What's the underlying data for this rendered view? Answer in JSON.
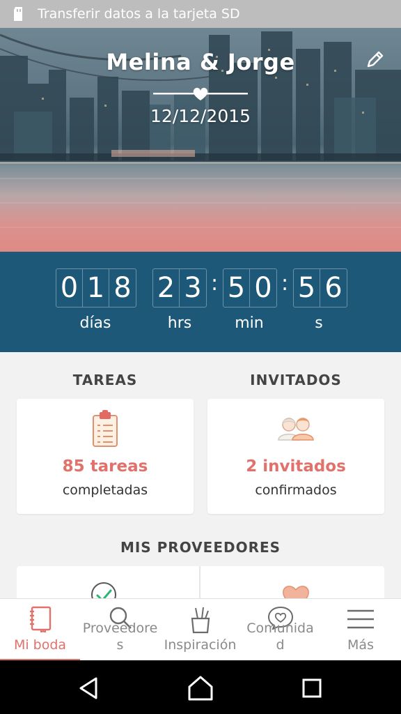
{
  "status_bar": {
    "text": "Transferir datos a la tarjeta SD"
  },
  "hero": {
    "couple_names": "Melina & Jorge",
    "wedding_date": "12/12/2015"
  },
  "countdown": {
    "days": [
      "0",
      "1",
      "8"
    ],
    "hours": [
      "2",
      "3"
    ],
    "minutes": [
      "5",
      "0"
    ],
    "seconds": [
      "5",
      "6"
    ],
    "separator": ":",
    "labels": {
      "days": "días",
      "hours": "hrs",
      "minutes": "min",
      "seconds": "s"
    }
  },
  "tasks": {
    "title": "TAREAS",
    "count": "85 tareas",
    "caption": "completadas",
    "icon": "clipboard-checklist-icon"
  },
  "guests": {
    "title": "INVITADOS",
    "count": "2 invitados",
    "caption": "confirmados",
    "icon": "couple-avatars-icon"
  },
  "providers": {
    "title": "MIS PROVEEDORES",
    "icons": [
      "check-circle-icon",
      "heart-icon"
    ]
  },
  "bottom_nav": {
    "items": [
      {
        "label": "Mi boda",
        "icon": "notebook-icon",
        "active": true
      },
      {
        "label": "Proveedore\ns",
        "icon": "search-icon",
        "active": false
      },
      {
        "label": "Inspiración",
        "icon": "pencil-cup-icon",
        "active": false
      },
      {
        "label": "Comunida\nd",
        "icon": "heart-bubble-icon",
        "active": false
      },
      {
        "label": "Más",
        "icon": "hamburger-menu-icon",
        "active": false
      }
    ]
  },
  "colors": {
    "accent": "#e0716b",
    "countdown_bg": "#1d5878",
    "background": "#f2f2f2"
  }
}
